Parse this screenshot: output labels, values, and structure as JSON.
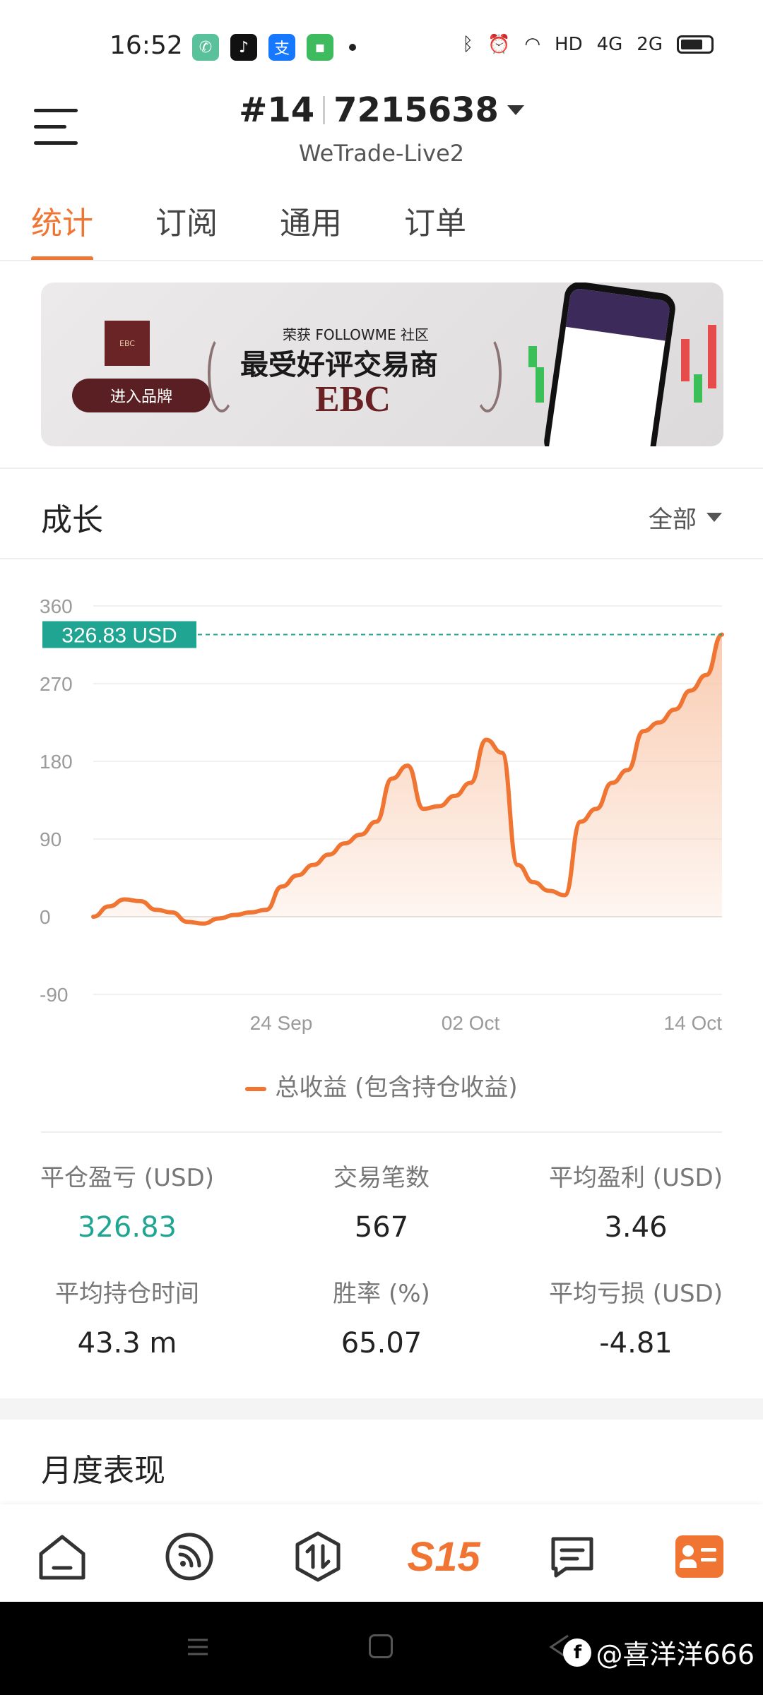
{
  "status_bar": {
    "time": "16:52",
    "network": "HD",
    "signal_1": "4G",
    "signal_2": "2G"
  },
  "header": {
    "account_prefix": "#14",
    "account_number": "7215638",
    "server": "WeTrade-Live2"
  },
  "tabs": [
    {
      "label": "统计",
      "active": true
    },
    {
      "label": "订阅",
      "active": false
    },
    {
      "label": "通用",
      "active": false
    },
    {
      "label": "订单",
      "active": false
    }
  ],
  "banner": {
    "subtitle": "荣获 FOLLOWME 社区",
    "title": "最受好评交易商",
    "brand": "EBC",
    "button": "进入品牌"
  },
  "growth": {
    "title": "成长",
    "filter": "全部"
  },
  "chart_data": {
    "type": "area",
    "current_label": "326.83 USD",
    "current_value": 326.83,
    "y_ticks": [
      "360",
      "270",
      "180",
      "90",
      "0",
      "-90"
    ],
    "x_ticks": [
      "24 Sep",
      "02 Oct",
      "14 Oct"
    ],
    "ylim": [
      -90,
      360
    ],
    "series": [
      {
        "name": "总收益 (包含持仓收益)",
        "values": [
          0,
          12,
          20,
          18,
          8,
          5,
          -6,
          -8,
          -2,
          2,
          5,
          8,
          35,
          48,
          60,
          72,
          85,
          95,
          110,
          160,
          175,
          125,
          128,
          140,
          155,
          205,
          190,
          60,
          40,
          30,
          25,
          110,
          125,
          155,
          170,
          215,
          225,
          240,
          262,
          280,
          326.83
        ]
      }
    ],
    "line_color": "#f07533",
    "fill_color": "#f9c9ad",
    "label_color": "#1fa592"
  },
  "stats": {
    "closed_pl": {
      "label": "平仓盈亏 (USD)",
      "value": "326.83"
    },
    "trades": {
      "label": "交易笔数",
      "value": "567"
    },
    "avg_profit": {
      "label": "平均盈利 (USD)",
      "value": "3.46"
    },
    "avg_hold": {
      "label": "平均持仓时间",
      "value": "43.3 m"
    },
    "win_rate": {
      "label": "胜率 (%)",
      "value": "65.07"
    },
    "avg_loss": {
      "label": "平均亏损 (USD)",
      "value": "-4.81"
    }
  },
  "monthly": {
    "title": "月度表现"
  },
  "bottom_nav": [
    {
      "icon": "home-icon"
    },
    {
      "icon": "feed-icon"
    },
    {
      "icon": "trade-icon"
    },
    {
      "icon": "s15-logo",
      "label": "S15"
    },
    {
      "icon": "message-icon"
    },
    {
      "icon": "profile-icon"
    }
  ],
  "watermark": "@喜洋洋666"
}
